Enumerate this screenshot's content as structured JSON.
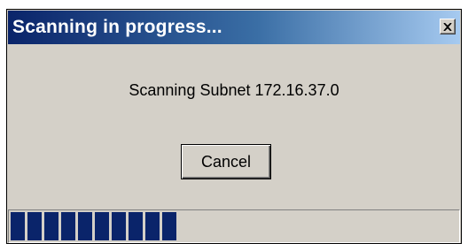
{
  "window": {
    "title": "Scanning in progress...",
    "message": "Scanning Subnet 172.16.37.0"
  },
  "buttons": {
    "cancel_label": "Cancel",
    "close_icon": "close-icon"
  },
  "progress": {
    "fraction": 0.27,
    "blocks": 10
  },
  "colors": {
    "title_bar_start": "#0a246a",
    "title_bar_end": "#a6caf0",
    "window_bg": "#d4d0c8",
    "progress_fill": "#0a246a"
  }
}
